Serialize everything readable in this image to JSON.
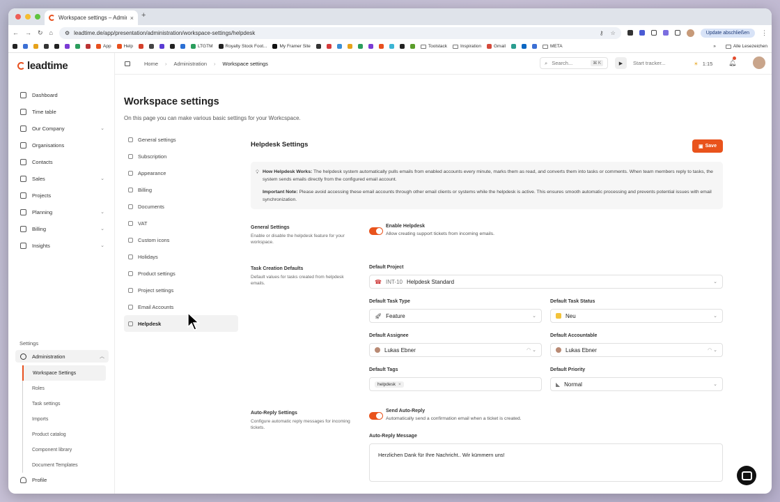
{
  "browser": {
    "tab_title": "Workspace settings – Admin",
    "url": "leadtime.de/app/presentation/administration/workspace-settings/helpdesk",
    "update_button": "Update abschließen",
    "bookmarks": [
      "App",
      "Help",
      "LTGTM",
      "Royalty Stock Foot...",
      "My Framer Site",
      "Toolstack",
      "Inspiration",
      "Gmail",
      "META"
    ],
    "all_bookmarks": "Alle Lesezeichen"
  },
  "app": {
    "logo": "leadtime",
    "accent": "#e9531c"
  },
  "sidebar": {
    "items": [
      {
        "label": "Dashboard",
        "icon": "gauge-icon",
        "chev": false
      },
      {
        "label": "Time table",
        "icon": "calendar-icon",
        "chev": false
      },
      {
        "label": "Our Company",
        "icon": "building-icon",
        "chev": true
      },
      {
        "label": "Organisations",
        "icon": "organisation-icon",
        "chev": false
      },
      {
        "label": "Contacts",
        "icon": "contacts-icon",
        "chev": false
      },
      {
        "label": "Sales",
        "icon": "handshake-icon",
        "chev": true
      },
      {
        "label": "Projects",
        "icon": "projects-icon",
        "chev": false
      },
      {
        "label": "Planning",
        "icon": "planning-icon",
        "chev": true
      },
      {
        "label": "Billing",
        "icon": "billing-icon",
        "chev": true
      },
      {
        "label": "Insights",
        "icon": "chart-icon",
        "chev": true
      }
    ],
    "settings_label": "Settings",
    "admin_label": "Administration",
    "admin_sub": [
      "Workspace Settings",
      "Roles",
      "Task settings",
      "Imports",
      "Product catalog",
      "Component library",
      "Document Templates"
    ],
    "profile_label": "Profile"
  },
  "topbar": {
    "breadcrumb": [
      "Home",
      "Administration",
      "Workspace settings"
    ],
    "search_placeholder": "Search...",
    "search_shortcut": "⌘ K",
    "tracker_label": "Start tracker...",
    "timer": "1:15"
  },
  "page": {
    "title": "Workspace settings",
    "description": "On this page you can make various basic settings for your Workcspace."
  },
  "settings_nav": [
    {
      "label": "General settings",
      "active": false
    },
    {
      "label": "Subscription",
      "active": false
    },
    {
      "label": "Appearance",
      "active": false
    },
    {
      "label": "Billing",
      "active": false
    },
    {
      "label": "Documents",
      "active": false
    },
    {
      "label": "VAT",
      "active": false
    },
    {
      "label": "Custom icons",
      "active": false
    },
    {
      "label": "Holidays",
      "active": false
    },
    {
      "label": "Product settings",
      "active": false
    },
    {
      "label": "Project settings",
      "active": false
    },
    {
      "label": "Email Accounts",
      "active": false
    },
    {
      "label": "Helpdesk",
      "active": true
    }
  ],
  "helpdesk": {
    "title": "Helpdesk Settings",
    "save_label": "Save",
    "info_how_title": "How Helpdesk Works:",
    "info_how_text": "The helpdesk system automatically pulls emails from enabled accounts every minute, marks them as read, and converts them into tasks or comments. When team members reply to tasks, the system sends emails directly from the configured email account.",
    "info_note_title": "Important Note:",
    "info_note_text": "Please avoid accessing these email accounts through other email clients or systems while the helpdesk is active. This ensures smooth automatic processing and prevents potential issues with email synchronization.",
    "general": {
      "label": "General Settings",
      "sub": "Enable or disable the helpdesk feature for your workspace.",
      "toggle_label": "Enable Helpdesk",
      "toggle_sub": "Allow creating support tickets from incoming emails.",
      "enabled": true
    },
    "task_defaults": {
      "label": "Task Creation Defaults",
      "sub": "Default values for tasks created from helpdesk emails.",
      "project_label": "Default Project",
      "project_code": "INT-10",
      "project_value": "Helpdesk Standard",
      "type_label": "Default Task Type",
      "type_value": "Feature",
      "status_label": "Default Task Status",
      "status_value": "Neu",
      "assignee_label": "Default Assignee",
      "assignee_value": "Lukas Ebner",
      "accountable_label": "Default Accountable",
      "accountable_value": "Lukas Ebner",
      "tags_label": "Default Tags",
      "tag_value": "helpdesk",
      "priority_label": "Default Priority",
      "priority_value": "Normal"
    },
    "auto_reply": {
      "label": "Auto-Reply Settings",
      "sub": "Configure automatic reply messages for incoming tickets.",
      "toggle_label": "Send Auto-Reply",
      "toggle_sub": "Automatically send a confirmation email when a ticket is created.",
      "enabled": true,
      "message_label": "Auto-Reply Message",
      "message_value": "Herzlichen Dank für Ihre Nachricht.. Wir kümmern uns!"
    }
  }
}
